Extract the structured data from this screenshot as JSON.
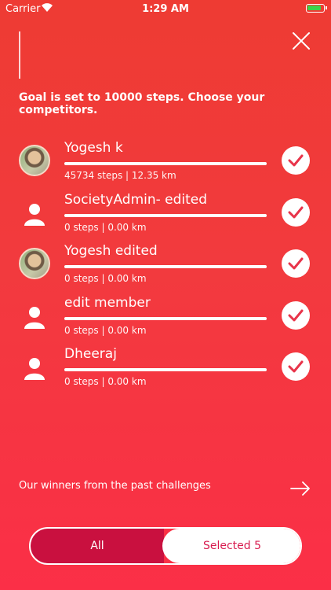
{
  "status_bar": {
    "carrier": "Carrier",
    "time": "1:29 AM"
  },
  "header": {
    "goal_text": "Goal is set to 10000 steps. Choose your competitors."
  },
  "members": [
    {
      "name": "Yogesh k",
      "stats": "45734 steps | 12.35 km",
      "avatar": "photo",
      "selected": true
    },
    {
      "name": "SocietyAdmin- edited",
      "stats": "0 steps | 0.00 km",
      "avatar": "person-icon",
      "selected": true
    },
    {
      "name": "Yogesh edited",
      "stats": "0 steps | 0.00 km",
      "avatar": "photo",
      "selected": true
    },
    {
      "name": "edit member",
      "stats": "0 steps | 0.00 km",
      "avatar": "person-icon",
      "selected": true
    },
    {
      "name": "Dheeraj",
      "stats": "0 steps | 0.00 km",
      "avatar": "person-icon",
      "selected": true
    }
  ],
  "footer": {
    "winners_text": "Our winners from the past challenges"
  },
  "toggle": {
    "all_label": "All",
    "selected_label": "Selected 5",
    "active": "selected"
  },
  "colors": {
    "accent": "#c9103f",
    "background_top": "#ee3b33",
    "background_bottom": "#fb2f47",
    "check": "#e8344a"
  }
}
